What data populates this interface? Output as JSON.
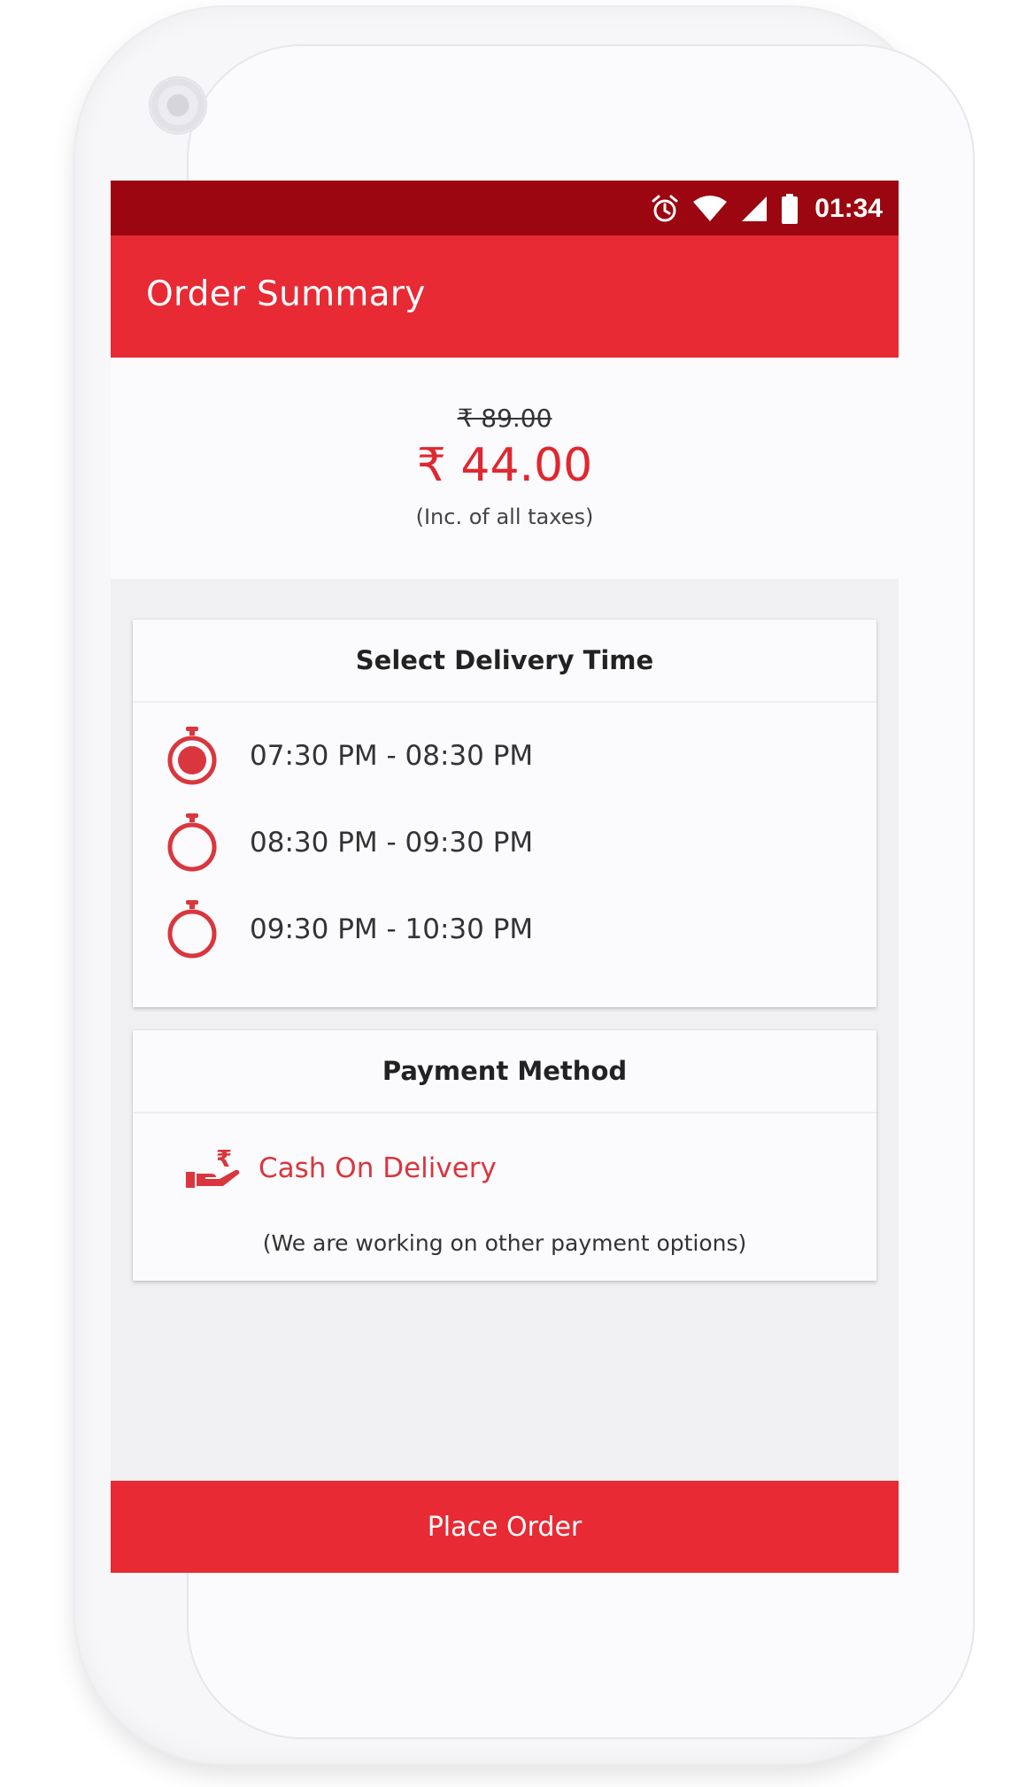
{
  "status_bar": {
    "time": "01:34",
    "icons": [
      "alarm-icon",
      "wifi-icon",
      "signal-icon",
      "battery-icon"
    ]
  },
  "app_bar": {
    "title": "Order Summary"
  },
  "price": {
    "original": "₹ 89.00",
    "current": "₹ 44.00",
    "tax_note": "(Inc. of all taxes)"
  },
  "delivery": {
    "title": "Select Delivery Time",
    "slots": [
      {
        "label": "07:30 PM - 08:30 PM",
        "selected": true
      },
      {
        "label": "08:30 PM - 09:30 PM",
        "selected": false
      },
      {
        "label": "09:30 PM - 10:30 PM",
        "selected": false
      }
    ]
  },
  "payment": {
    "title": "Payment Method",
    "method": "Cash On Delivery",
    "method_icon": "cash-in-hand-icon",
    "note": "(We are working on other payment options)"
  },
  "actions": {
    "place_order": "Place Order"
  },
  "colors": {
    "primary": "#e72a34",
    "status_bar": "#9b0610",
    "accent_text": "#e0272f",
    "background": "#f0eff2"
  }
}
